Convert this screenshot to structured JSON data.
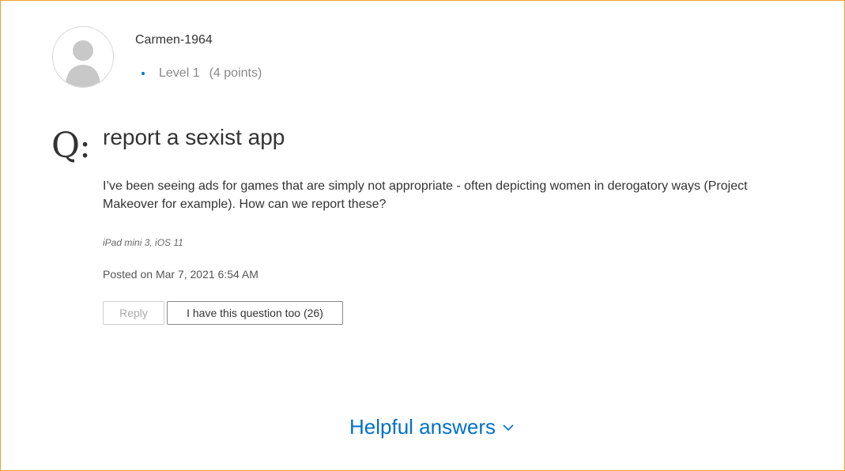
{
  "author": {
    "username": "Carmen-1964",
    "level": "Level 1",
    "points": "(4 points)",
    "avatar_icon": "user-silhouette-icon"
  },
  "question": {
    "marker": "Q:",
    "title": "report a sexist app",
    "body": "I’ve been seeing ads for games that are simply not appropriate - often depicting women in derogatory ways (Project Makeover for example). How can we report these?",
    "device": "iPad mini 3, iOS 11",
    "posted": "Posted on Mar 7, 2021 6:54 AM"
  },
  "actions": {
    "reply_label": "Reply",
    "question_too_label": "I have this question too (26)"
  },
  "helpful": {
    "label": "Helpful answers",
    "icon": "chevron-down-icon"
  },
  "colors": {
    "accent": "#0070c9",
    "frame_border": "#f0a030",
    "text": "#333333",
    "muted": "#888888"
  }
}
